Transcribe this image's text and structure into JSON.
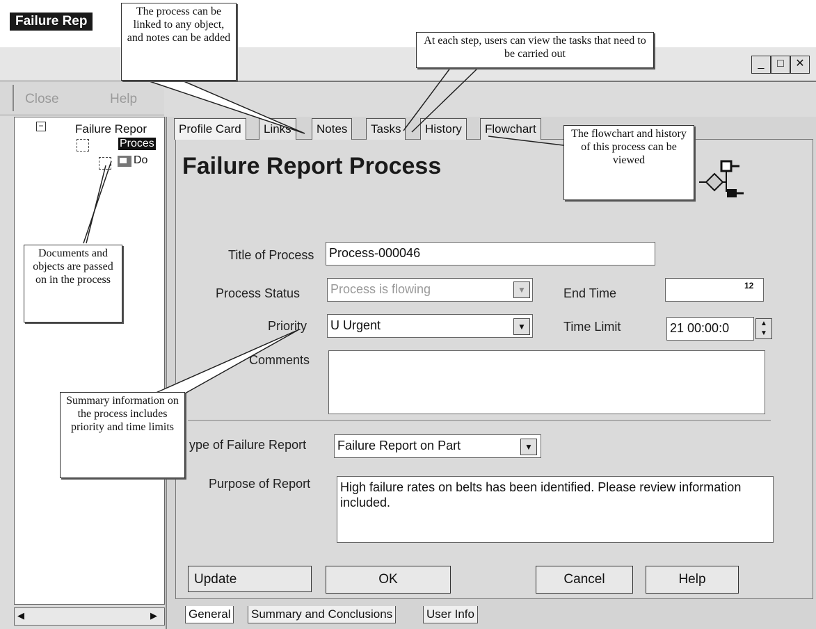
{
  "window": {
    "title": "Failure Rep",
    "controls": [
      "_",
      "□",
      "✕"
    ]
  },
  "menu": {
    "close_label": "Close",
    "help_label": "Help"
  },
  "tree": {
    "root_label": "Failure Repor",
    "expander": "−",
    "process_label": "Proces",
    "document_label": "Do"
  },
  "tabs": [
    "Profile Card",
    "Links",
    "Notes",
    "Tasks",
    "History",
    "Flowchart"
  ],
  "active_tab": "Profile Card",
  "heading": "Failure Report Process",
  "form": {
    "title_label": "Title of Process",
    "title_value": "Process-000046",
    "status_label": "Process Status",
    "status_value": "Process is flowing",
    "end_time_label": "End Time",
    "end_time_value": "",
    "end_time_icon": "12",
    "priority_label": "Priority",
    "priority_value": "U Urgent",
    "time_limit_label": "Time Limit",
    "time_limit_value": "21 00:00:0",
    "comments_label": "Comments",
    "comments_value": "",
    "failure_type_label": "ype of Failure Report",
    "failure_type_value": "Failure Report on Part",
    "purpose_label": "Purpose of Report",
    "purpose_value": "High failure rates on belts has been identified. Please review information included."
  },
  "buttons": {
    "update": "Update",
    "ok": "OK",
    "cancel": "Cancel",
    "help": "Help"
  },
  "bottom_tabs": [
    "General",
    "Summary and Conclusions",
    "User Info"
  ],
  "callouts": {
    "link_notes": "The process can be linked to any object, and notes can be added",
    "tasks": "At each step, users can view the tasks that need to be carried out",
    "flowchart": "The flowchart and history of this process can be viewed",
    "documents": "Documents and objects are passed on in the process",
    "summary": "Summary information on the process includes priority and time limits"
  },
  "icons": [
    "minimize-icon",
    "maximize-icon",
    "close-icon",
    "dropdown-arrow-icon",
    "calendar-icon",
    "spin-icon",
    "flowchart-icon",
    "document-icon"
  ]
}
